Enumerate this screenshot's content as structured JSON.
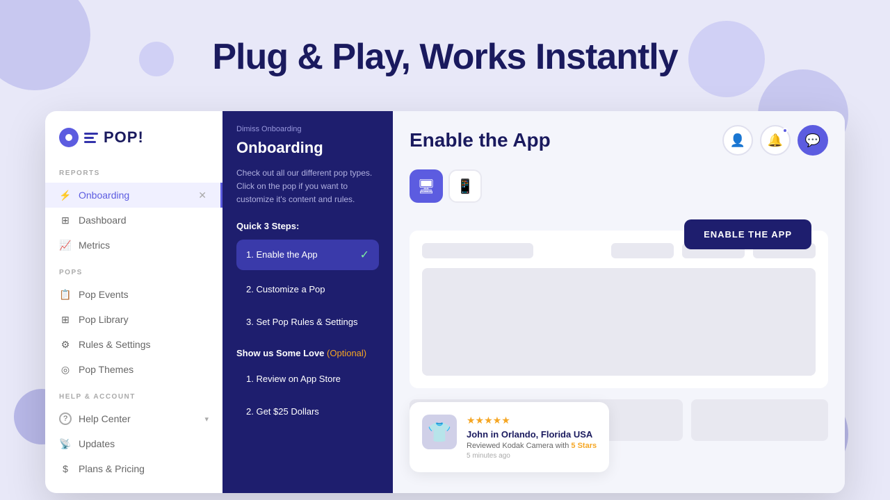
{
  "page": {
    "title": "Plug & Play, Works Instantly",
    "background_color": "#e8e8f8"
  },
  "sidebar": {
    "logo_text": "POP!",
    "sections": [
      {
        "label": "REPORTS",
        "items": [
          {
            "id": "onboarding",
            "label": "Onboarding",
            "icon": "⚡",
            "active": true,
            "hasClose": true
          },
          {
            "id": "dashboard",
            "label": "Dashboard",
            "icon": "⊞",
            "active": false
          },
          {
            "id": "metrics",
            "label": "Metrics",
            "icon": "📈",
            "active": false
          }
        ]
      },
      {
        "label": "POPS",
        "items": [
          {
            "id": "pop-events",
            "label": "Pop Events",
            "icon": "📋",
            "active": false
          },
          {
            "id": "pop-library",
            "label": "Pop Library",
            "icon": "⊞",
            "active": false
          },
          {
            "id": "rules-settings",
            "label": "Rules & Settings",
            "icon": "⚙",
            "active": false
          },
          {
            "id": "pop-themes",
            "label": "Pop Themes",
            "icon": "◎",
            "active": false
          }
        ]
      },
      {
        "label": "HELP & ACCOUNT",
        "items": [
          {
            "id": "help-center",
            "label": "Help Center",
            "icon": "?",
            "active": false,
            "hasChevron": true
          },
          {
            "id": "updates",
            "label": "Updates",
            "icon": "📡",
            "active": false
          },
          {
            "id": "plans-pricing",
            "label": "Plans & Pricing",
            "icon": "$",
            "active": false
          }
        ]
      }
    ]
  },
  "onboarding_panel": {
    "dismiss_label": "Dimiss Onboarding",
    "title": "Onboarding",
    "description": "Check out all our different pop types. Click on the pop if you want to customize it's content and rules.",
    "quick_steps_label": "Quick 3 Steps:",
    "steps": [
      {
        "number": "1.",
        "label": "Enable the App",
        "active": true,
        "checked": true
      },
      {
        "number": "2.",
        "label": "Customize a Pop",
        "active": false
      },
      {
        "number": "3.",
        "label": "Set Pop Rules & Settings",
        "active": false
      }
    ],
    "show_love_label": "Show us Some Love",
    "optional_tag": "(Optional)",
    "love_steps": [
      {
        "number": "1.",
        "label": "Review on App Store"
      },
      {
        "number": "2.",
        "label": "Get $25 Dollars"
      }
    ]
  },
  "main": {
    "title": "Enable the App",
    "enable_button_label": "ENABLE THE APP",
    "device_tabs": [
      {
        "id": "desktop",
        "icon": "🖥",
        "active": true
      },
      {
        "id": "mobile",
        "icon": "📱",
        "active": false
      }
    ],
    "header_icons": [
      {
        "id": "user",
        "icon": "👤",
        "active": false
      },
      {
        "id": "bell",
        "icon": "🔔",
        "active": false,
        "has_dot": true
      },
      {
        "id": "chat",
        "icon": "💬",
        "active": true
      }
    ],
    "review_card": {
      "stars": "★★★★★",
      "name": "John in Orlando, Florida USA",
      "text_prefix": "Reviewed Kodak Camera with",
      "stars_label": "5 Stars",
      "time": "5 minutes ago"
    }
  }
}
